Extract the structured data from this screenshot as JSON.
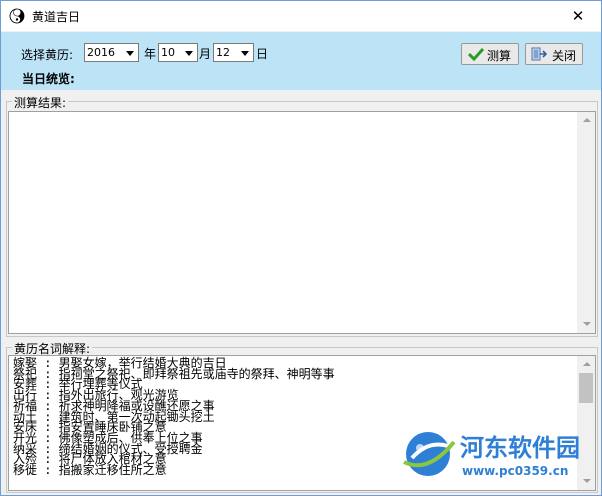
{
  "window": {
    "title": "黄道吉日",
    "close_glyph": "✕"
  },
  "toolbar": {
    "select_label": "选择黄历:",
    "year_value": "2016",
    "year_unit": "年",
    "month_value": "10",
    "month_unit": "月",
    "day_value": "12",
    "day_unit": "日",
    "summary_label": "当日统览:",
    "calc_label": "测算",
    "close_label": "关闭"
  },
  "results": {
    "label": "测算结果:"
  },
  "glossary": {
    "label": "黄历名词解释:",
    "lines": [
      "嫁娶 : 男娶女嫁，举行结婚大典的吉日",
      "祭祀 : 指祠堂之祭祀、即拜祭祖先或庙寺的祭拜、神明等事",
      "安葬 : 举行埋葬等仪式",
      "出行 : 指外出旅行、观光游览",
      "祈福 : 祈求神明降福或设醮还愿之事",
      "动土 : 建筑时、第一次动起锄头挖土",
      "安床 : 指安置睡床卧铺之意",
      "开光 : 佛像塑成后、供奉上位之事",
      "纳采 : 缔结婚姻的仪式、受授聘金",
      "入殓 : 将尸体放入棺材之意",
      "移徙 : 指搬家迁移住所之意"
    ]
  },
  "watermark": {
    "site_name": "河东软件园",
    "url": "www.pc0359.cn"
  },
  "colors": {
    "toolbar_bg": "#bce3f6",
    "check_green": "#2a9a2a",
    "watermark_blue": "#2e7fd6"
  }
}
